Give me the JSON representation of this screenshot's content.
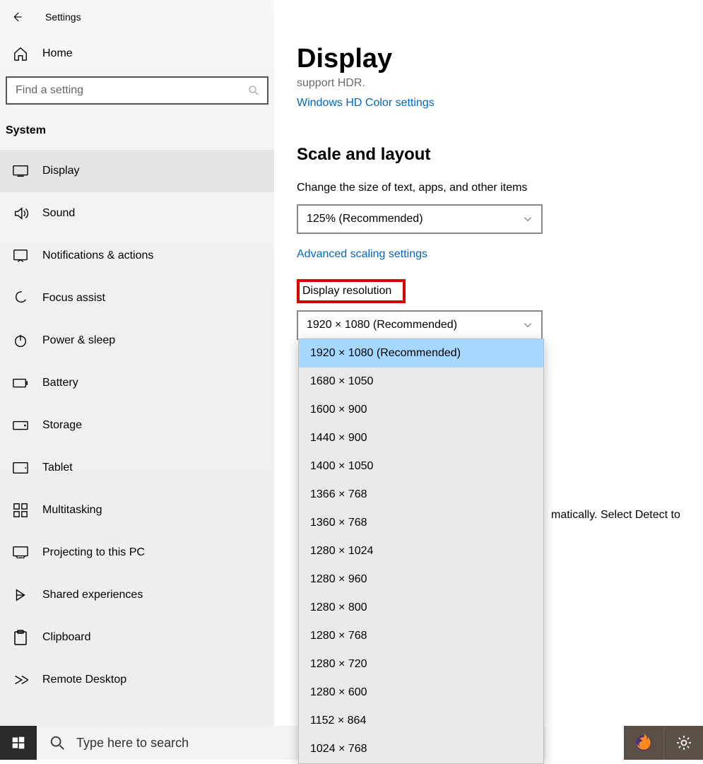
{
  "titlebar": {
    "title": "Settings"
  },
  "sidebar": {
    "home": "Home",
    "search_placeholder": "Find a setting",
    "section": "System",
    "items": [
      {
        "label": "Display"
      },
      {
        "label": "Sound"
      },
      {
        "label": "Notifications & actions"
      },
      {
        "label": "Focus assist"
      },
      {
        "label": "Power & sleep"
      },
      {
        "label": "Battery"
      },
      {
        "label": "Storage"
      },
      {
        "label": "Tablet"
      },
      {
        "label": "Multitasking"
      },
      {
        "label": "Projecting to this PC"
      },
      {
        "label": "Shared experiences"
      },
      {
        "label": "Clipboard"
      },
      {
        "label": "Remote Desktop"
      }
    ]
  },
  "main": {
    "page_title": "Display",
    "hdr_cut": "support HDR.",
    "hdcolor_link": "Windows HD Color settings",
    "scale_heading": "Scale and layout",
    "scale_label": "Change the size of text, apps, and other items",
    "scale_value": "125% (Recommended)",
    "adv_scaling_link": "Advanced scaling settings",
    "resolution_label": "Display resolution",
    "resolution_value": "1920 × 1080 (Recommended)",
    "resolution_options": [
      "1920 × 1080 (Recommended)",
      "1680 × 1050",
      "1600 × 900",
      "1440 × 900",
      "1400 × 1050",
      "1366 × 768",
      "1360 × 768",
      "1280 × 1024",
      "1280 × 960",
      "1280 × 800",
      "1280 × 768",
      "1280 × 720",
      "1280 × 600",
      "1152 × 864",
      "1024 × 768"
    ],
    "behind_text": "matically. Select Detect to"
  },
  "taskbar": {
    "search_placeholder": "Type here to search"
  }
}
